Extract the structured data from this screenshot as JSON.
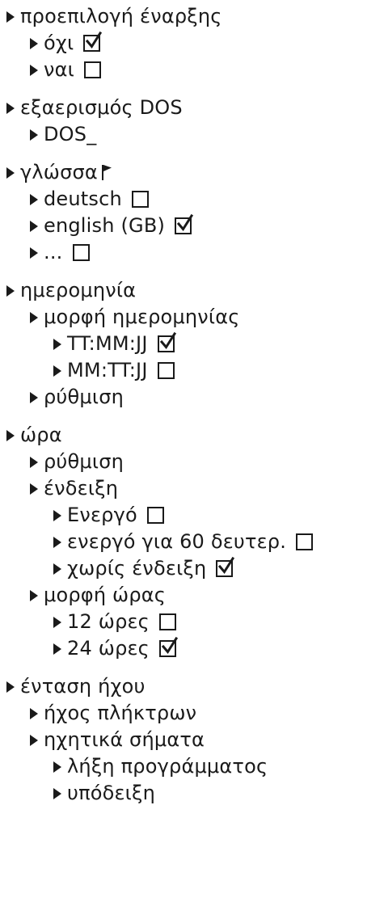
{
  "menu": [
    {
      "level": 0,
      "label": "προεπιλογή έναρξης",
      "group_start": true
    },
    {
      "level": 1,
      "label": "όχι",
      "checkbox": true,
      "checked": true
    },
    {
      "level": 1,
      "label": "ναι",
      "checkbox": true,
      "checked": false
    },
    {
      "level": 0,
      "label": "εξαερισμός DOS",
      "group_start": true
    },
    {
      "level": 1,
      "label": "DOS_"
    },
    {
      "level": 0,
      "label": "γλώσσα",
      "group_start": true,
      "icon": "flag-icon"
    },
    {
      "level": 1,
      "label": "deutsch",
      "checkbox": true,
      "checked": false
    },
    {
      "level": 1,
      "label": "english (GB)",
      "checkbox": true,
      "checked": true
    },
    {
      "level": 1,
      "label": "...",
      "checkbox": true,
      "checked": false
    },
    {
      "level": 0,
      "label": "ημερομηνία",
      "group_start": true
    },
    {
      "level": 1,
      "label": "μορφή ημερομηνίας"
    },
    {
      "level": 2,
      "label": "TT:MM:JJ",
      "checkbox": true,
      "checked": true
    },
    {
      "level": 2,
      "label": "MM:TT:JJ",
      "checkbox": true,
      "checked": false
    },
    {
      "level": 1,
      "label": "ρύθμιση"
    },
    {
      "level": 0,
      "label": "ώρα",
      "group_start": true
    },
    {
      "level": 1,
      "label": "ρύθμιση"
    },
    {
      "level": 1,
      "label": "ένδειξη"
    },
    {
      "level": 2,
      "label": "Ενεργό",
      "checkbox": true,
      "checked": false
    },
    {
      "level": 2,
      "label": "ενεργό για 60 δευτερ.",
      "checkbox": true,
      "checked": false
    },
    {
      "level": 2,
      "label": "χωρίς ένδειξη",
      "checkbox": true,
      "checked": true
    },
    {
      "level": 1,
      "label": "μορφή ώρας"
    },
    {
      "level": 2,
      "label": "12 ώρες",
      "checkbox": true,
      "checked": false
    },
    {
      "level": 2,
      "label": "24 ώρες",
      "checkbox": true,
      "checked": true
    },
    {
      "level": 0,
      "label": "ένταση ήχου",
      "group_start": true
    },
    {
      "level": 1,
      "label": "ήχος πλήκτρων"
    },
    {
      "level": 1,
      "label": "ηχητικά σήματα"
    },
    {
      "level": 2,
      "label": "λήξη προγράμματος"
    },
    {
      "level": 2,
      "label": "υπόδειξη"
    }
  ]
}
